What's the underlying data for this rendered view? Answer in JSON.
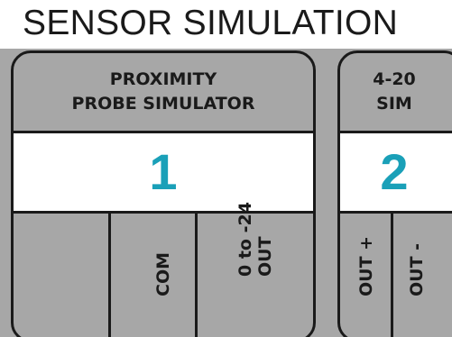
{
  "page": {
    "title": "SENSOR SIMULATION"
  },
  "colors": {
    "panel_gray": "#a7a7a7",
    "outline": "#1a1a1a",
    "window_white": "#ffffff",
    "number_accent": "#1aa0b8"
  },
  "modules": [
    {
      "header_lines": [
        "PROXIMITY",
        "PROBE SIMULATOR"
      ],
      "number": "1",
      "terminals": [
        {
          "lines": []
        },
        {
          "lines": [
            "COM"
          ]
        },
        {
          "lines": [
            "0 to -24",
            "OUT"
          ]
        }
      ]
    },
    {
      "header_lines": [
        "4-20",
        "SIM"
      ],
      "number": "2",
      "terminals": [
        {
          "lines": [
            "OUT +"
          ]
        },
        {
          "lines": [
            "OUT -"
          ]
        }
      ]
    }
  ]
}
